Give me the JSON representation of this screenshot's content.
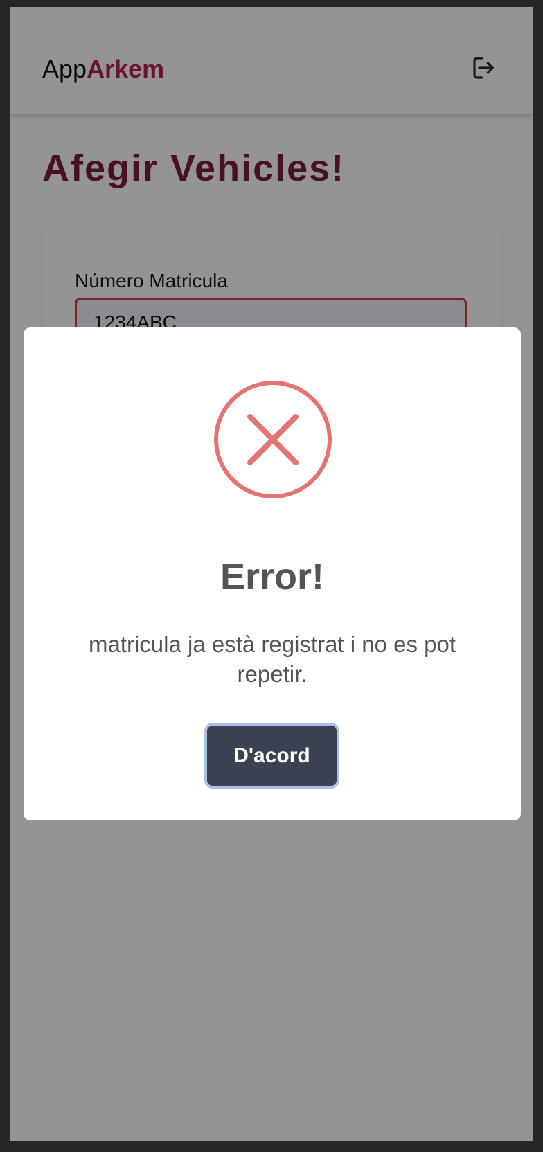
{
  "header": {
    "brand_prefix": "App",
    "brand_accent": "Arkem",
    "logout_icon": "logout-icon"
  },
  "page": {
    "title": "Afegir Vehicles!"
  },
  "form": {
    "plate_label": "Número Matricula",
    "plate_value": "1234ABC"
  },
  "modal": {
    "icon": "error-x-icon",
    "title": "Error!",
    "message": "matricula ja està registrat i no es pot repetir.",
    "confirm_label": "D'acord"
  },
  "colors": {
    "brand_accent": "#b3215a",
    "title": "#7a1e3c",
    "error": "#e57373",
    "button": "#3a4150",
    "button_focus_ring": "#a9c3e3"
  }
}
